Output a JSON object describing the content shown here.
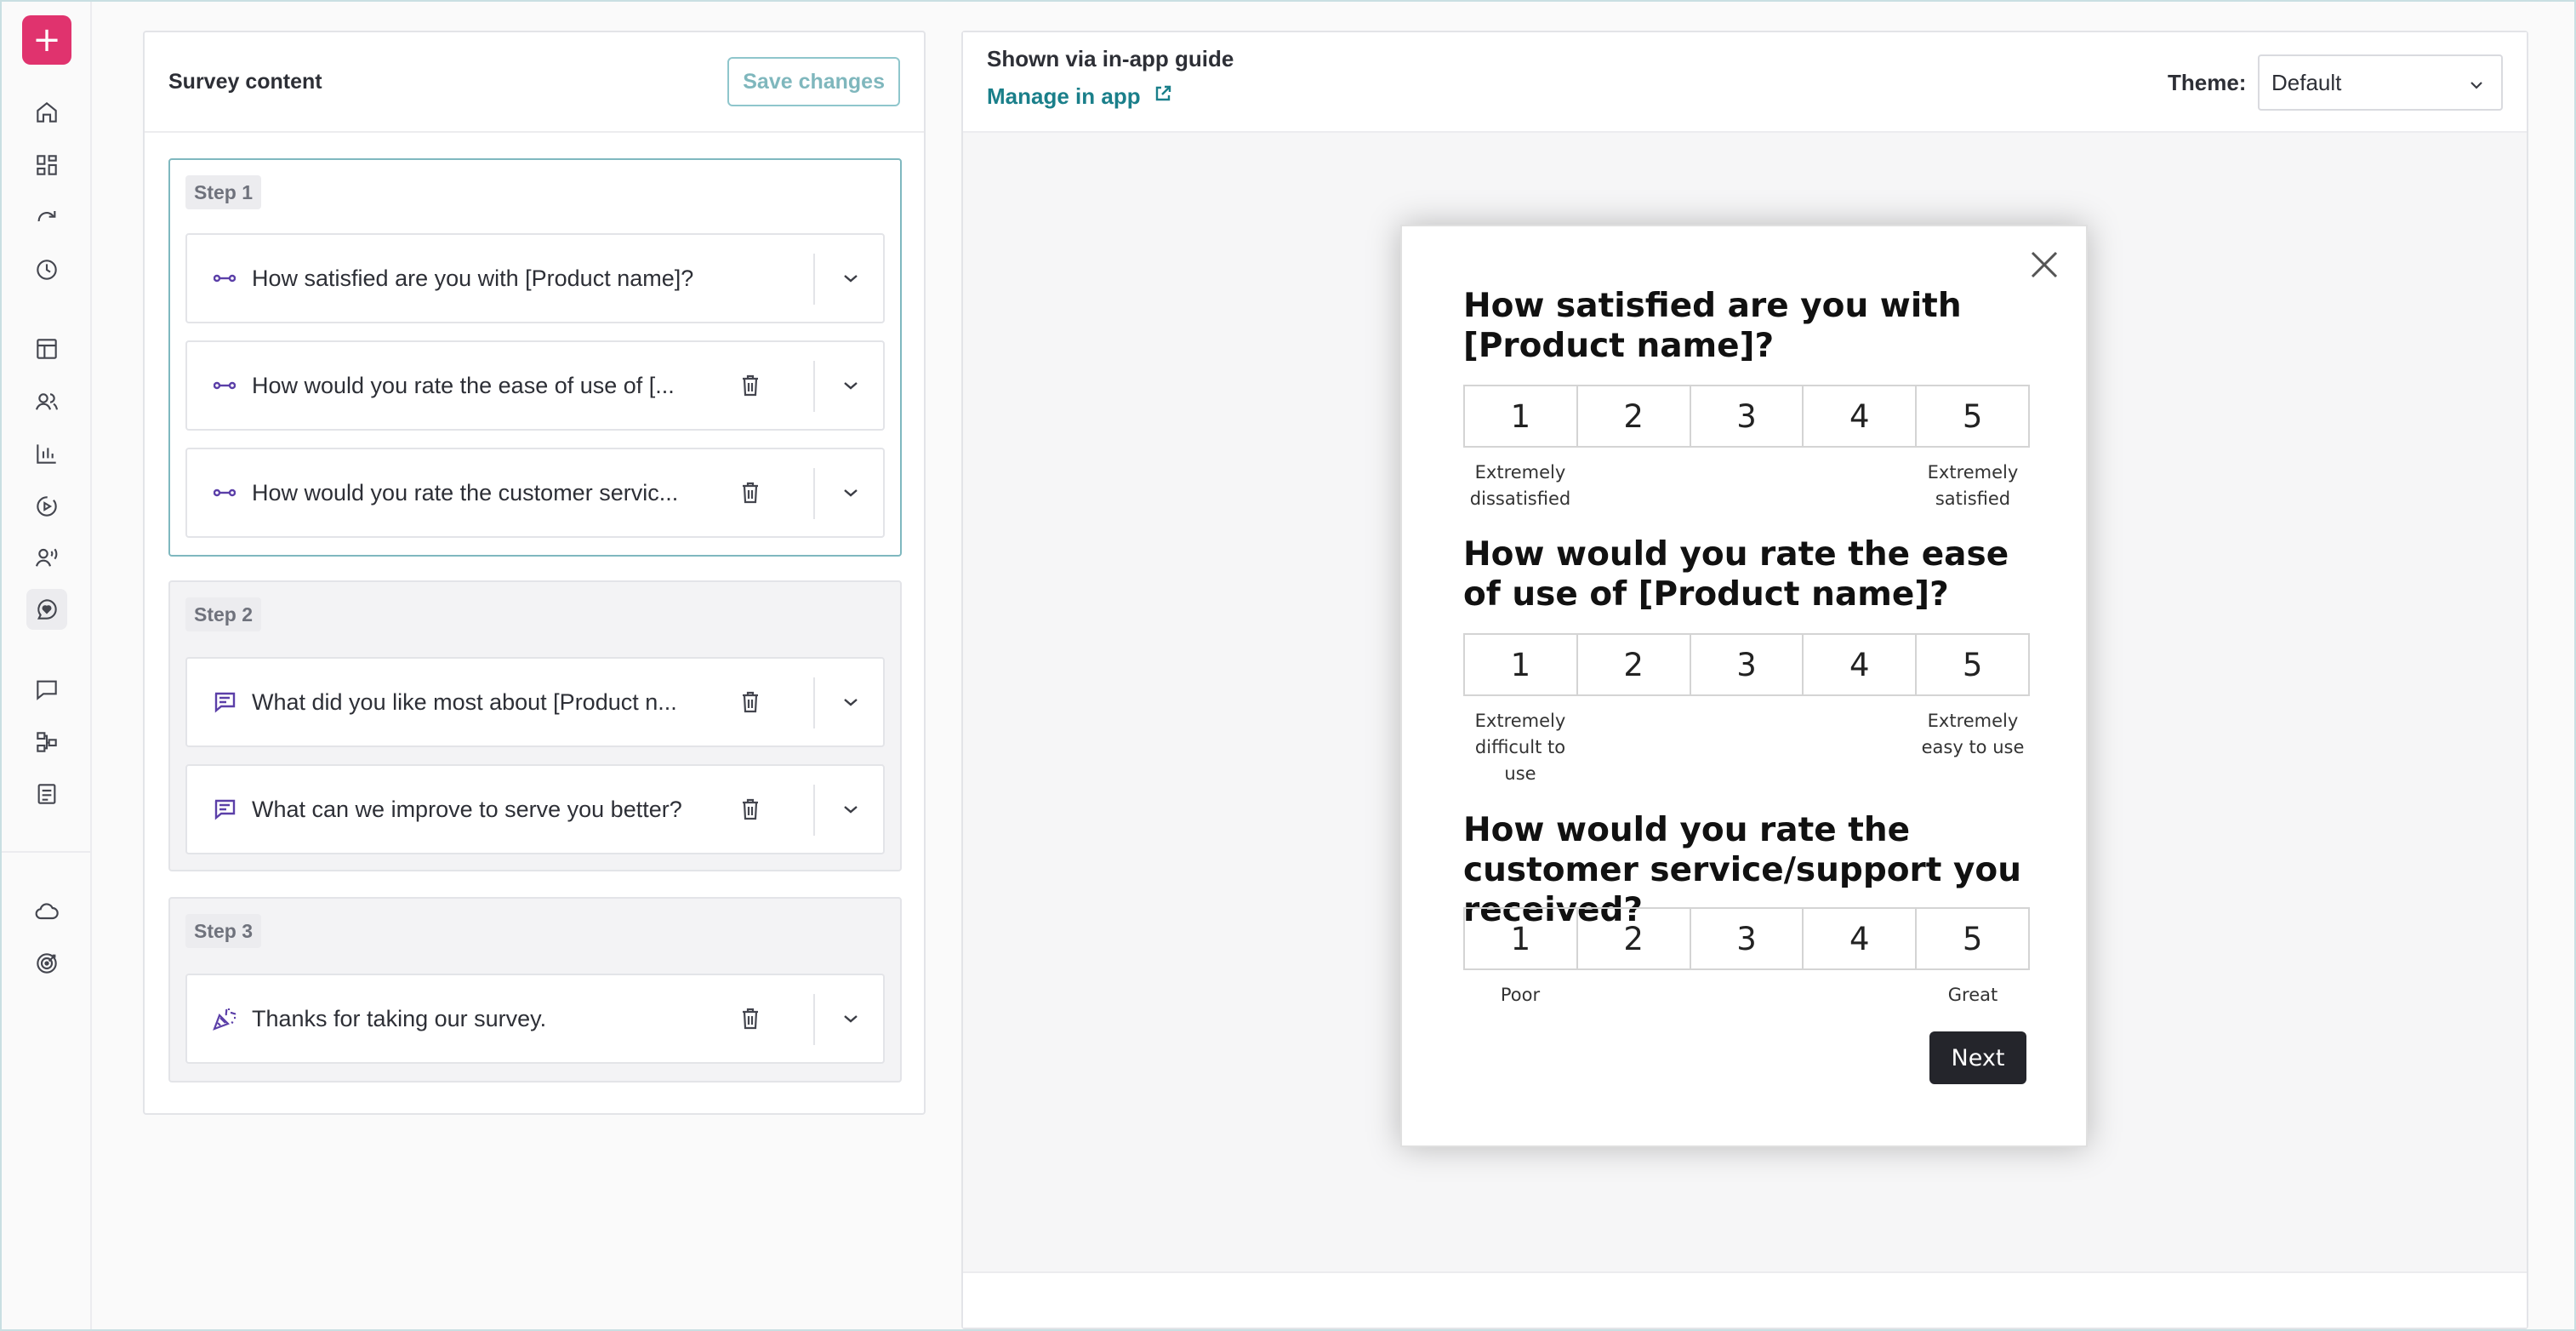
{
  "rail": {
    "add_label": "+",
    "icons": [
      "home-icon",
      "dashboard-icon",
      "redo-icon",
      "clock-icon",
      "layout-icon",
      "users-icon",
      "bar-chart-icon",
      "play-circle-icon",
      "voice-user-icon",
      "chat-heart-icon",
      "message-icon",
      "workflow-icon",
      "document-icon",
      "cloud-icon",
      "target-icon"
    ],
    "accent": "#e0336e"
  },
  "content": {
    "title": "Survey content",
    "save_label": "Save changes",
    "steps": [
      {
        "label": "Step 1",
        "questions": [
          {
            "icon": "scale-icon",
            "text": "How satisfied are you with [Product name]?"
          },
          {
            "icon": "scale-icon",
            "text": "How would you rate the ease of use of [..."
          },
          {
            "icon": "scale-icon",
            "text": "How would you rate the customer servic..."
          }
        ]
      },
      {
        "label": "Step 2",
        "questions": [
          {
            "icon": "text-response-icon",
            "text": "What did you like most about [Product n..."
          },
          {
            "icon": "text-response-icon",
            "text": "What can we improve to serve you better?"
          }
        ]
      },
      {
        "label": "Step 3",
        "questions": [
          {
            "icon": "party-popper-icon",
            "text": "Thanks for taking our survey."
          }
        ]
      }
    ]
  },
  "preview": {
    "shown_via": "Shown via in-app guide",
    "manage_link": "Manage in app",
    "theme_label": "Theme:",
    "theme_value": "Default",
    "link_color": "#1a7f8a"
  },
  "modal": {
    "questions": [
      {
        "title": "How satisfied are you with [Product name]?",
        "scale": [
          "1",
          "2",
          "3",
          "4",
          "5"
        ],
        "low": "Extremely dissatisfied",
        "high": "Extremely satisfied"
      },
      {
        "title": "How would you rate the ease of use of [Product name]?",
        "scale": [
          "1",
          "2",
          "3",
          "4",
          "5"
        ],
        "low": "Extremely difficult to use",
        "high": "Extremely easy to use"
      },
      {
        "title": "How would you rate the customer service/support you received?",
        "scale": [
          "1",
          "2",
          "3",
          "4",
          "5"
        ],
        "low": "Poor",
        "high": "Great"
      }
    ],
    "next_label": "Next"
  }
}
